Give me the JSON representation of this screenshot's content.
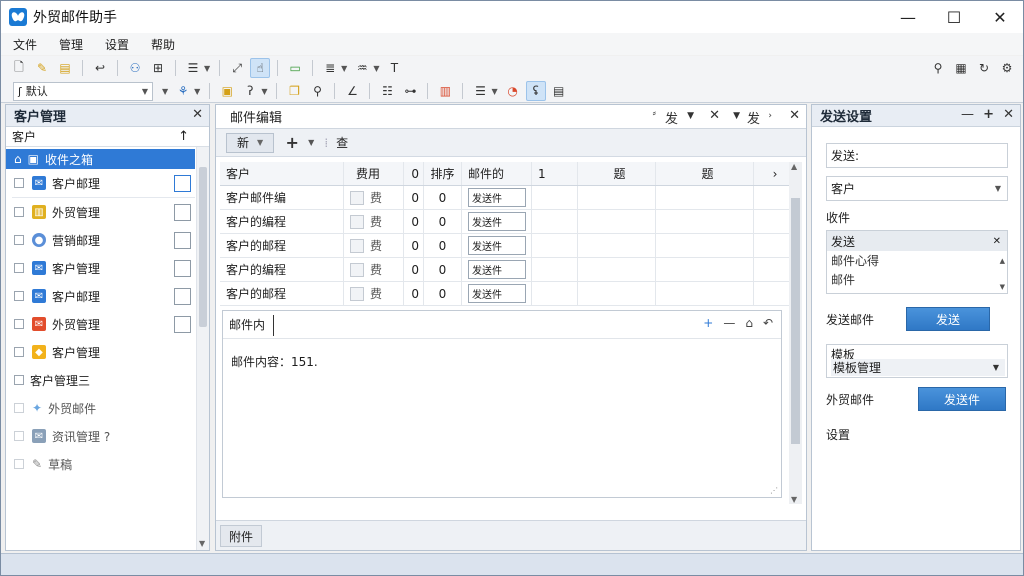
{
  "app": {
    "title": "外贸邮件助手",
    "minimize_icon": "minimize-icon",
    "maximize_icon": "maximize-icon",
    "close_icon": "close-icon"
  },
  "menu": [
    "文件",
    "管理",
    "设置",
    "帮助"
  ],
  "toolbar": {
    "combo_value": "默认"
  },
  "left_panel": {
    "title": "客户管理",
    "column_header": "客户",
    "items": [
      {
        "label": "收件之箱",
        "selected": true
      },
      {
        "label": "客户邮理"
      },
      {
        "label": "外贸管理"
      },
      {
        "label": "营销邮理"
      },
      {
        "label": "客户管理"
      },
      {
        "label": "客户邮理"
      },
      {
        "label": "外贸管理"
      },
      {
        "label": "客户管理"
      },
      {
        "label": "客户管理三"
      },
      {
        "label": "外贸邮件"
      },
      {
        "label": "资讯管理 ?"
      },
      {
        "label": "草稿"
      }
    ]
  },
  "center_panel": {
    "title": "邮件编辑",
    "tab_label": "发",
    "tab_label_2": "发",
    "sub_button": "新",
    "sub_add": "+",
    "sub_label": "查",
    "columns": [
      "客户",
      "费用",
      "0",
      "排序",
      "邮件的",
      "1",
      "题",
      "题"
    ],
    "rows": [
      {
        "name": "客户邮件编",
        "tag": "费",
        "n1": "0",
        "n2": "0",
        "field": "发送件"
      },
      {
        "name": "客户的编程",
        "tag": "费",
        "n1": "0",
        "n2": "0",
        "field": "发送件"
      },
      {
        "name": "客户的邮程",
        "tag": "费",
        "n1": "0",
        "n2": "0",
        "field": "发送件"
      },
      {
        "name": "客户的编程",
        "tag": "费",
        "n1": "0",
        "n2": "0",
        "field": "发送件"
      },
      {
        "name": "客户的邮程",
        "tag": "费",
        "n1": "0",
        "n2": "0",
        "field": "发送件"
      }
    ],
    "editor_label": "邮件内",
    "editor_text": "邮件内容：151.",
    "footer_tab": "附件"
  },
  "right_panel": {
    "title": "发送设置",
    "field1": "发送:",
    "field2": "客户",
    "label_recipients": "收件",
    "list_header": "发送",
    "list_items": [
      "邮件心得",
      "邮件"
    ],
    "label_send": "发送邮件",
    "send_button": "发送",
    "group_title": "模板",
    "group_value": "模板管理",
    "label_trade": "外贸邮件",
    "trade_button": "发送件",
    "label_settings": "设置"
  }
}
